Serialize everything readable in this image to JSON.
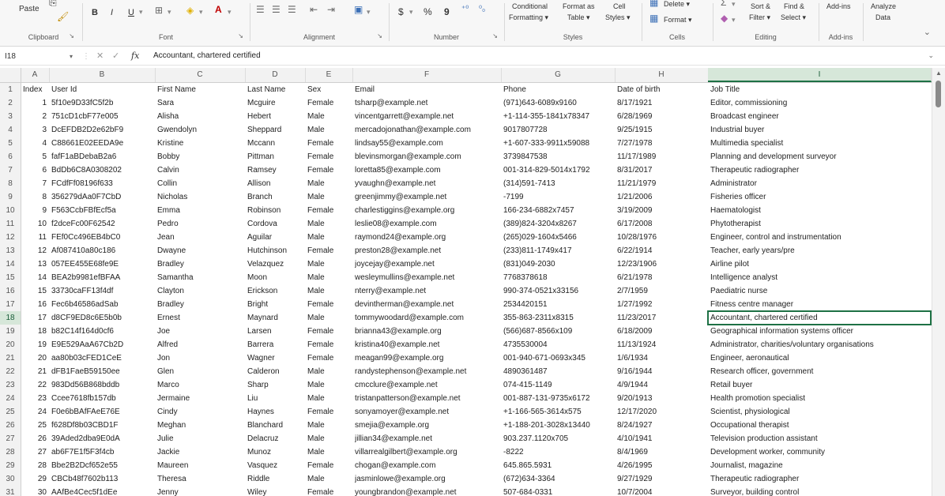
{
  "ribbon": {
    "clipboard": {
      "paste_label": "Paste",
      "group_label": "Clipboard"
    },
    "font": {
      "group_label": "Font",
      "bold": "B",
      "italic": "I",
      "underline": "U"
    },
    "alignment": {
      "group_label": "Alignment"
    },
    "number": {
      "group_label": "Number",
      "currency": "$",
      "percent": "%",
      "comma": "9"
    },
    "styles": {
      "group_label": "Styles",
      "conditional": [
        "Conditional",
        "Formatting ▾"
      ],
      "format_table": [
        "Format as",
        "Table ▾"
      ],
      "cell_styles": [
        "Cell",
        "Styles ▾"
      ]
    },
    "cells": {
      "group_label": "Cells",
      "delete": "Delete ▾",
      "format": "Format ▾"
    },
    "editing": {
      "group_label": "Editing",
      "sort": [
        "Sort &",
        "Filter ▾"
      ],
      "find": [
        "Find &",
        "Select ▾"
      ]
    },
    "addins": {
      "group_label": "Add-ins",
      "label": "Add-ins"
    },
    "analyze": {
      "label": [
        "Analyze",
        "Data"
      ]
    }
  },
  "formula_bar": {
    "name_box": "I18",
    "fx": "fx",
    "content": "Accountant, chartered certified"
  },
  "columns": [
    "A",
    "B",
    "C",
    "D",
    "E",
    "F",
    "G",
    "H",
    "I"
  ],
  "active_column": "I",
  "active_row": "18",
  "rows": [
    {
      "r": "1",
      "c": [
        "Index",
        "User Id",
        "First Name",
        "Last Name",
        "Sex",
        "Email",
        "Phone",
        "Date of birth",
        "Job Title"
      ]
    },
    {
      "r": "2",
      "c": [
        "1",
        "5f10e9D33fC5f2b",
        "Sara",
        "Mcguire",
        "Female",
        "tsharp@example.net",
        "(971)643-6089x9160",
        "8/17/1921",
        "Editor, commissioning"
      ]
    },
    {
      "r": "3",
      "c": [
        "2",
        "751cD1cbF77e005",
        "Alisha",
        "Hebert",
        "Male",
        "vincentgarrett@example.net",
        "+1-114-355-1841x78347",
        "6/28/1969",
        "Broadcast engineer"
      ]
    },
    {
      "r": "4",
      "c": [
        "3",
        "DcEFDB2D2e62bF9",
        "Gwendolyn",
        "Sheppard",
        "Male",
        "mercadojonathan@example.com",
        "9017807728",
        "9/25/1915",
        "Industrial buyer"
      ]
    },
    {
      "r": "5",
      "c": [
        "4",
        "C88661E02EEDA9e",
        "Kristine",
        "Mccann",
        "Female",
        "lindsay55@example.com",
        "+1-607-333-9911x59088",
        "7/27/1978",
        "Multimedia specialist"
      ]
    },
    {
      "r": "6",
      "c": [
        "5",
        "fafF1aBDebaB2a6",
        "Bobby",
        "Pittman",
        "Female",
        "blevinsmorgan@example.com",
        "3739847538",
        "11/17/1989",
        "Planning and development surveyor"
      ]
    },
    {
      "r": "7",
      "c": [
        "6",
        "BdDb6C8A0308202",
        "Calvin",
        "Ramsey",
        "Female",
        "loretta85@example.com",
        "001-314-829-5014x1792",
        "8/31/2017",
        "Therapeutic radiographer"
      ]
    },
    {
      "r": "8",
      "c": [
        "7",
        "FCdfFf08196f633",
        "Collin",
        "Allison",
        "Male",
        "yvaughn@example.net",
        "(314)591-7413",
        "11/21/1979",
        "Administrator"
      ]
    },
    {
      "r": "9",
      "c": [
        "8",
        "356279dAa0F7CbD",
        "Nicholas",
        "Branch",
        "Male",
        "greenjimmy@example.net",
        "-7199",
        "1/21/2006",
        "Fisheries officer"
      ]
    },
    {
      "r": "10",
      "c": [
        "9",
        "F563CcbFBfEcf5a",
        "Emma",
        "Robinson",
        "Female",
        "charlestiggins@example.org",
        "166-234-6882x7457",
        "3/19/2009",
        "Haematologist"
      ]
    },
    {
      "r": "11",
      "c": [
        "10",
        "f2dceFc00F62542",
        "Pedro",
        "Cordova",
        "Male",
        "leslie08@example.com",
        "(389)824-3204x8267",
        "6/17/2008",
        "Phytotherapist"
      ]
    },
    {
      "r": "12",
      "c": [
        "11",
        "FEf0Cc496EB4bC0",
        "Jean",
        "Aguilar",
        "Male",
        "raymond24@example.org",
        "(265)029-1604x5466",
        "10/28/1976",
        "Engineer, control and instrumentation"
      ]
    },
    {
      "r": "13",
      "c": [
        "12",
        "Af087410a80c186",
        "Dwayne",
        "Hutchinson",
        "Female",
        "preston28@example.net",
        "(233)811-1749x417",
        "6/22/1914",
        "Teacher, early years/pre"
      ]
    },
    {
      "r": "14",
      "c": [
        "13",
        "057EE455E68fe9E",
        "Bradley",
        "Velazquez",
        "Male",
        "joycejay@example.net",
        "(831)049-2030",
        "12/23/1906",
        "Airline pilot"
      ]
    },
    {
      "r": "15",
      "c": [
        "14",
        "BEA2b9981efBFAA",
        "Samantha",
        "Moon",
        "Male",
        "wesleymullins@example.net",
        "7768378618",
        "6/21/1978",
        "Intelligence analyst"
      ]
    },
    {
      "r": "16",
      "c": [
        "15",
        "33730caFF13f4df",
        "Clayton",
        "Erickson",
        "Male",
        "nterry@example.net",
        "990-374-0521x33156",
        "2/7/1959",
        "Paediatric nurse"
      ]
    },
    {
      "r": "17",
      "c": [
        "16",
        "Fec6b46586adSab",
        "Bradley",
        "Bright",
        "Female",
        "devintherman@example.net",
        "2534420151",
        "1/27/1992",
        "Fitness centre manager"
      ]
    },
    {
      "r": "18",
      "c": [
        "17",
        "d8CF9ED8c6E5b0b",
        "Ernest",
        "Maynard",
        "Male",
        "tommywoodard@example.com",
        "355-863-2311x8315",
        "11/23/2017",
        "Accountant, chartered certified"
      ]
    },
    {
      "r": "19",
      "c": [
        "18",
        "b82C14f164d0cf6",
        "Joe",
        "Larsen",
        "Female",
        "brianna43@example.org",
        "(566)687-8566x109",
        "6/18/2009",
        "Geographical information systems officer"
      ]
    },
    {
      "r": "20",
      "c": [
        "19",
        "E9E529AaA67Cb2D",
        "Alfred",
        "Barrera",
        "Female",
        "kristina40@example.net",
        "4735530004",
        "11/13/1924",
        "Administrator, charities/voluntary organisations"
      ]
    },
    {
      "r": "21",
      "c": [
        "20",
        "aa80b03cFED1CeE",
        "Jon",
        "Wagner",
        "Female",
        "meagan99@example.org",
        "001-940-671-0693x345",
        "1/6/1934",
        "Engineer, aeronautical"
      ]
    },
    {
      "r": "22",
      "c": [
        "21",
        "dFB1FaeB59150ee",
        "Glen",
        "Calderon",
        "Male",
        "randystephenson@example.net",
        "4890361487",
        "9/16/1944",
        "Research officer, government"
      ]
    },
    {
      "r": "23",
      "c": [
        "22",
        "983Dd56B868bddb",
        "Marco",
        "Sharp",
        "Male",
        "cmcclure@example.net",
        "074-415-1149",
        "4/9/1944",
        "Retail buyer"
      ]
    },
    {
      "r": "24",
      "c": [
        "23",
        "Ccee7618fb157db",
        "Jermaine",
        "Liu",
        "Male",
        "tristanpatterson@example.net",
        "001-887-131-9735x6172",
        "9/20/1913",
        "Health promotion specialist"
      ]
    },
    {
      "r": "25",
      "c": [
        "24",
        "F0e6bBAfFAeE76E",
        "Cindy",
        "Haynes",
        "Female",
        "sonyamoyer@example.net",
        "+1-166-565-3614x575",
        "12/17/2020",
        "Scientist, physiological"
      ]
    },
    {
      "r": "26",
      "c": [
        "25",
        "f628Df8b03CBD1F",
        "Meghan",
        "Blanchard",
        "Male",
        "smejia@example.org",
        "+1-188-201-3028x13440",
        "8/24/1927",
        "Occupational therapist"
      ]
    },
    {
      "r": "27",
      "c": [
        "26",
        "39Aded2dba9E0dA",
        "Julie",
        "Delacruz",
        "Male",
        "jillian34@example.net",
        "903.237.1120x705",
        "4/10/1941",
        "Television production assistant"
      ]
    },
    {
      "r": "28",
      "c": [
        "27",
        "ab6F7E1f5F3f4cb",
        "Jackie",
        "Munoz",
        "Male",
        "villarrealgilbert@example.org",
        "-8222",
        "8/4/1969",
        "Development worker, community"
      ]
    },
    {
      "r": "29",
      "c": [
        "28",
        "Bbe2B2Dcf652e55",
        "Maureen",
        "Vasquez",
        "Female",
        "chogan@example.com",
        "645.865.5931",
        "4/26/1995",
        "Journalist, magazine"
      ]
    },
    {
      "r": "30",
      "c": [
        "29",
        "CBCb48f7602b113",
        "Theresa",
        "Riddle",
        "Male",
        "jasminlowe@example.org",
        "(672)634-3364",
        "9/27/1929",
        "Therapeutic radiographer"
      ]
    },
    {
      "r": "31",
      "c": [
        "30",
        "AAfBe4Cec5f1dEe",
        "Jenny",
        "Wiley",
        "Female",
        "youngbrandon@example.net",
        "507-684-0331",
        "10/7/2004",
        "Surveyor, building control"
      ]
    }
  ]
}
